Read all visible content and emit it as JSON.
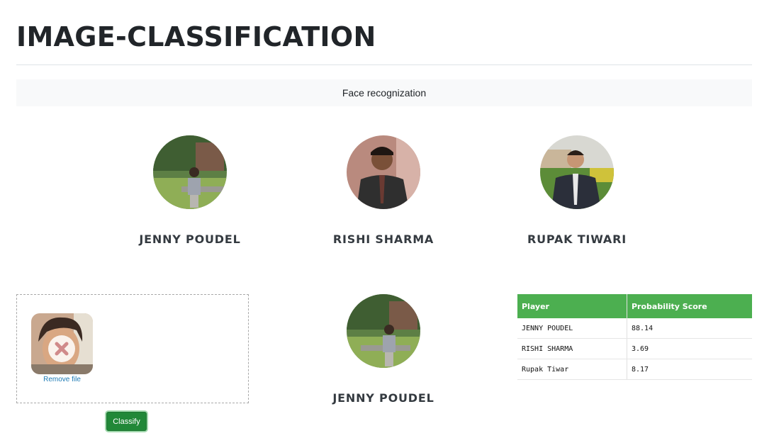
{
  "page": {
    "title": "IMAGE-CLASSIFICATION",
    "banner": "Face recognization"
  },
  "players": [
    {
      "name": "JENNY POUDEL"
    },
    {
      "name": "RISHI SHARMA"
    },
    {
      "name": "RUPAK TIWARI"
    }
  ],
  "upload": {
    "remove_label": "Remove file",
    "classify_label": "Classify"
  },
  "result": {
    "name": "JENNY POUDEL"
  },
  "table": {
    "headers": [
      "Player",
      "Probability Score"
    ],
    "rows": [
      {
        "player": "JENNY POUDEL",
        "score": "88.14"
      },
      {
        "player": "RISHI SHARMA",
        "score": "3.69"
      },
      {
        "player": "Rupak Tiwar",
        "score": "8.17"
      }
    ]
  },
  "colors": {
    "table_header": "#4caf50",
    "classify_button": "#218838",
    "link": "#1d7ab5"
  }
}
